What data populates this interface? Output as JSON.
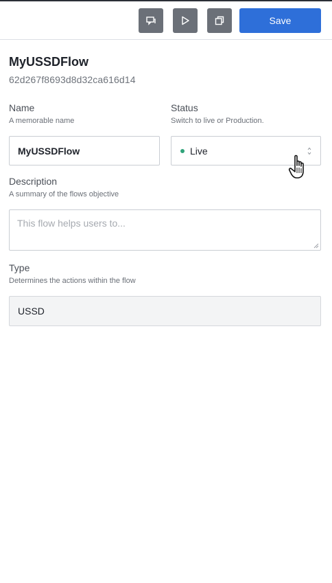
{
  "toolbar": {
    "icons": [
      "comment-icon",
      "play-icon",
      "copy-icon"
    ],
    "save_label": "Save",
    "save_color": "#2e6fd9"
  },
  "flow": {
    "title": "MyUSSDFlow",
    "id": "62d267f8693d8d32ca616d14"
  },
  "form": {
    "name": {
      "label": "Name",
      "hint": "A memorable name",
      "value": "MyUSSDFlow"
    },
    "status": {
      "label": "Status",
      "hint": "Switch to live or Production.",
      "value": "Live",
      "dot_color": "#2fa37a"
    },
    "description": {
      "label": "Description",
      "hint": "A summary of the flows objective",
      "placeholder": "This flow helps users to..."
    },
    "type": {
      "label": "Type",
      "hint": "Determines the actions within the flow",
      "value": "USSD"
    }
  }
}
